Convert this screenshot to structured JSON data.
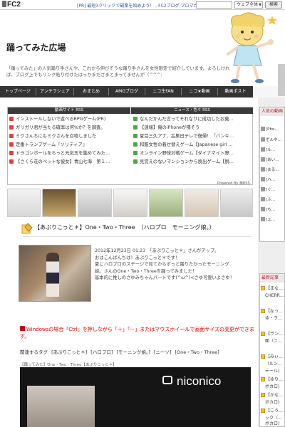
{
  "fc2bar": {
    "logo": "FC2",
    "ad_text": "[PR] 最短3クリックで副業を始めよう！ - FC2ブログ プロマガ",
    "search_select": "ウェブ全体",
    "search_button": "検索"
  },
  "header": {
    "title": "踊ってみた広場",
    "description": "「踊ってみた」の人気踊り手さんや、これから伸びそうな踊り手さんを女性限定で紹介しています。よろしければ、ブログ上でもリンク貼り付けたはっかまださまとまってませんが（^^^;"
  },
  "nav": {
    "items": [
      "トップページ",
      "アンチラシェア",
      "おまとめ",
      "AMGブログ",
      "ニコ生FAN",
      "ニコ★動画",
      "動画ポスト"
    ]
  },
  "rss": {
    "left_header": "動画サイト RSS",
    "right_header": "ニュース・色々 RSS",
    "left_items": [
      {
        "text": "インストールしないで遊べるRPGゲーム(PR)",
        "color": "#e04040"
      },
      {
        "text": "ガリガリ君が当たる確率は何%か？を調査。",
        "color": "#e04040"
      },
      {
        "text": "ミクさんちにもミクさんを召喚しました",
        "color": "#e04040"
      },
      {
        "text": "定番トランプゲーム『ソリティア』",
        "color": "#e04040"
      },
      {
        "text": "ドラゴンボールをちっと元気玉を集めてみた…",
        "color": "#e04040"
      },
      {
        "text": "【さくら荘のペットな彼女】青山七海　第１…",
        "color": "#e04040"
      }
    ],
    "right_items": [
      {
        "text": "なんだかんだ言ってそれなりに成功したお菓…",
        "color": "#4aa84a"
      },
      {
        "text": "【速報】俺のiPhoneが喋そう",
        "color": "#4aa84a"
      },
      {
        "text": "夏目三久アナ、古巣日テレで復帰！『バンキ…",
        "color": "#4aa84a"
      },
      {
        "text": "和服女性の着せ替えゲーム【Japanese girl …",
        "color": "#4aa84a"
      },
      {
        "text": "オンライン野球対戦ゲーム【ダイナマイト野…",
        "color": "#4aa84a"
      },
      {
        "text": "見覚えのないマンションから脱出ゲーム【脱…",
        "color": "#4aa84a"
      }
    ],
    "footer": "Powered By 楽RSS"
  },
  "entry": {
    "title": "【あぷりこっと＊】One・Two・Three　（ハロプロ　モーニング娘。）",
    "date_line": "2012年12月23日 01:23　「あぷりこっと＊」さんがアップ。",
    "body_lines": [
      "おはこんばんちは！あぷりこっと＊です！",
      "夏にハロプロのステージで見てからずっと踊りたかったモーニング",
      "娘。さんのOne・Two・Threeを踊ってみました！",
      "基本的に推しのさゆみちゃんパートです(^ω^)<さゆ可愛いよさゆ！"
    ],
    "notice": "Windowsの場合「Ctrl」を押しながら「＋」「－」またはマウスホイールで画面サイズの変更ができます。",
    "tags_label": "関連するタグ",
    "tags": [
      "[あぷりこっと＊]",
      "[ハロプロ]",
      "[モーニング娘。]",
      "[ニーソ]",
      "[One・Two・Three]"
    ],
    "video_label": "【踊ってみた】One・Two・Three【あぷりこっと＊】",
    "video_brand": "niconico"
  },
  "sidebar": {
    "ranking_title": "人気の動画",
    "ranking_items": [
      "[Pho…",
      "ポルネ…",
      "[ル…",
      "[あい…",
      "[まる…",
      "[ハ…",
      "[ぐ…",
      "[ふ…",
      "[ち…",
      "[ユ…"
    ],
    "recent_title": "最新記事",
    "recent_items": [
      "【まな…",
      "CHERR…",
      "【なっ…",
      "ゆ・ラ…",
      "【ラン…",
      "面（ニ…",
      "【みぃ…",
      "（ルン…",
      "テール)",
      "【ゆり…",
      "ボカロ)",
      "【かな…",
      "ボカロ)",
      "【こう…",
      "ック（…",
      "ボカロ)"
    ]
  }
}
